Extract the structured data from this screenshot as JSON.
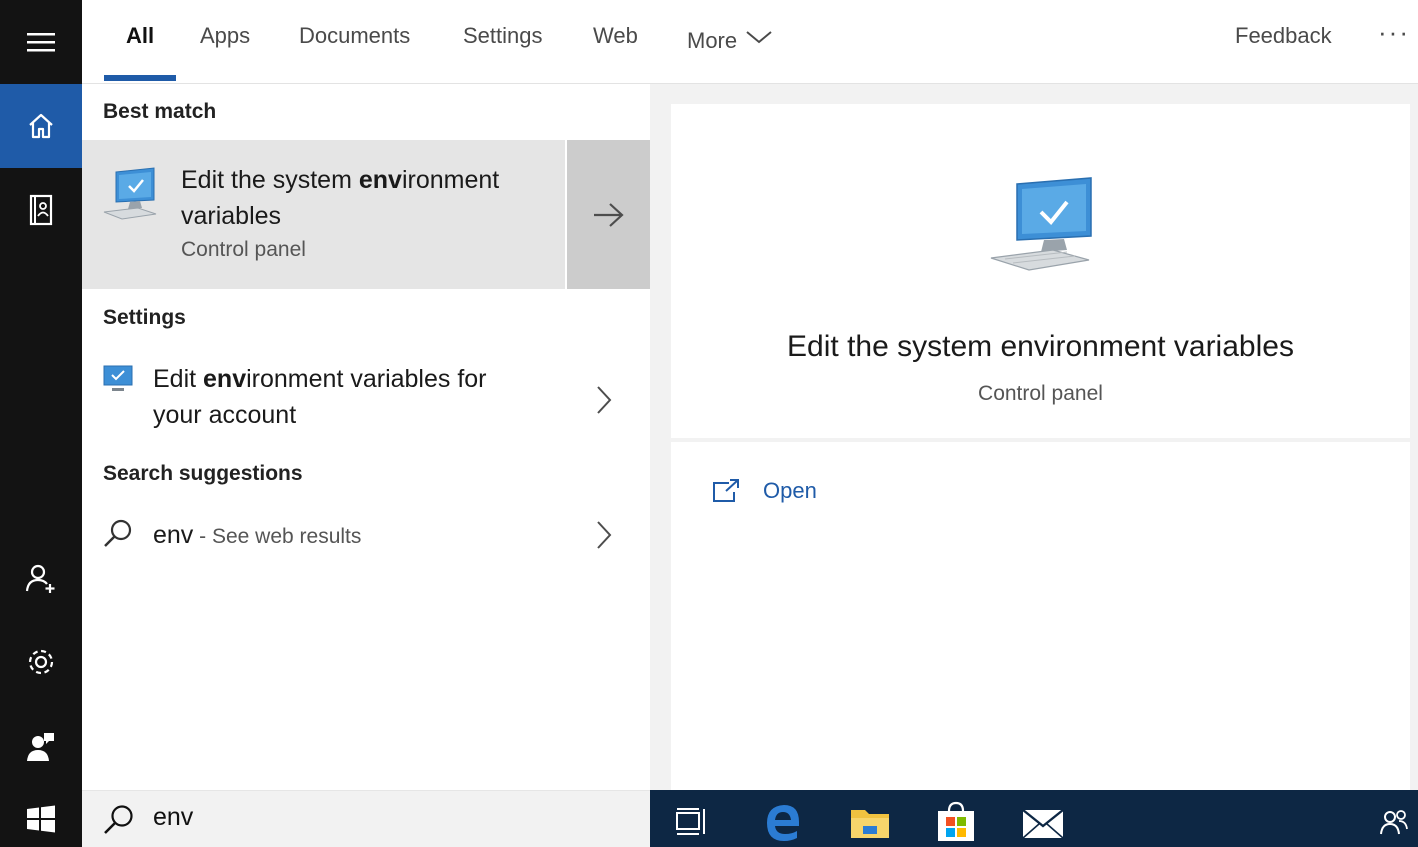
{
  "tabs": [
    {
      "label": "All",
      "active": true
    },
    {
      "label": "Apps"
    },
    {
      "label": "Documents"
    },
    {
      "label": "Settings"
    },
    {
      "label": "Web"
    },
    {
      "label": "More"
    }
  ],
  "header": {
    "feedback": "Feedback",
    "ellipsis": "···"
  },
  "rail": {
    "icons": [
      "hamburger-menu-icon",
      "home-icon",
      "notebook-icon",
      "person-add-icon",
      "gear-icon",
      "feedback-person-icon"
    ],
    "active": "home-icon"
  },
  "results": {
    "best_match": {
      "section": "Best match",
      "title_pre": "Edit the system ",
      "title_hl": "env",
      "title_post": "ironment variables",
      "subtitle": "Control panel"
    },
    "settings": {
      "section": "Settings",
      "title_pre": "Edit ",
      "title_hl": "env",
      "title_post": "ironment variables for your account"
    },
    "suggestions": {
      "section": "Search suggestions",
      "term": "env",
      "suffix": " - See web results"
    }
  },
  "preview": {
    "title": "Edit the system environment variables",
    "subtitle": "Control panel",
    "action": "Open"
  },
  "search": {
    "value": "env"
  },
  "taskbar": {
    "icons": [
      "task-view-icon",
      "edge-icon",
      "file-explorer-icon",
      "store-icon",
      "mail-icon",
      "people-icon"
    ]
  },
  "colors": {
    "accent": "#1f5ba8",
    "rail": "#131313",
    "taskbar": "#0d2744",
    "selected": "#e5e5e5"
  }
}
